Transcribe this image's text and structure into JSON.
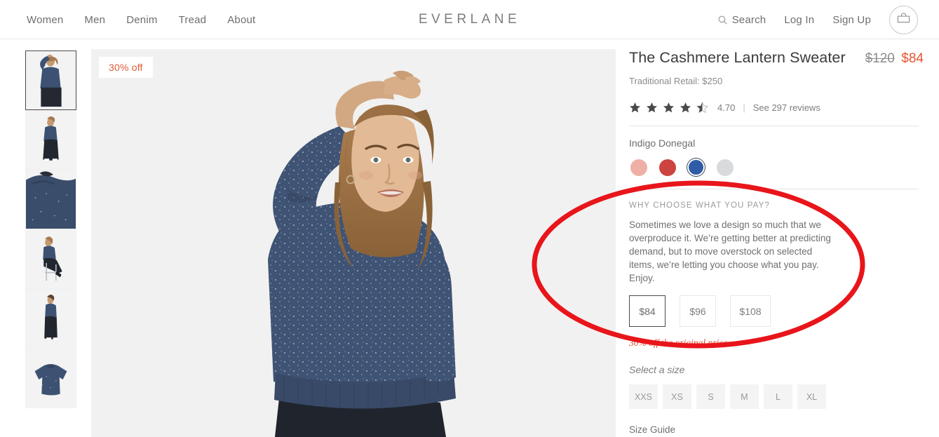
{
  "header": {
    "brand": "EVERLANE",
    "nav": [
      {
        "label": "Women"
      },
      {
        "label": "Men"
      },
      {
        "label": "Denim"
      },
      {
        "label": "Tread"
      },
      {
        "label": "About"
      }
    ],
    "search_label": "Search",
    "login_label": "Log In",
    "signup_label": "Sign Up",
    "search_icon": "search-icon",
    "bag_icon": "shopping-bag-icon"
  },
  "gallery": {
    "badge": "30% off",
    "thumbnails": [
      {
        "alt": "model arm raised",
        "selected": true
      },
      {
        "alt": "model full length standing"
      },
      {
        "alt": "fabric detail close up"
      },
      {
        "alt": "model seated on stool"
      },
      {
        "alt": "model side view"
      },
      {
        "alt": "flat lay sweater"
      }
    ]
  },
  "product": {
    "title": "The Cashmere Lantern Sweater",
    "price_original": "$120",
    "price_current": "$84",
    "retail": "Traditional Retail: $250",
    "rating_value": "4.70",
    "rating_stars": 4.5,
    "rating_separator": "|",
    "reviews_link": "See 297 reviews",
    "color_name": "Indigo Donegal",
    "colors": [
      {
        "name": "blush",
        "hex": "#eeb0a6",
        "selected": false
      },
      {
        "name": "red",
        "hex": "#cc4340",
        "selected": false
      },
      {
        "name": "indigo",
        "hex": "#2f5ca6",
        "selected": true
      },
      {
        "name": "light-grey",
        "hex": "#d9dadc",
        "selected": false
      }
    ]
  },
  "choose_price": {
    "heading": "WHY CHOOSE WHAT YOU PAY?",
    "body": "Sometimes we love a design so much that we overproduce it. We’re getting better at predicting demand, but to move overstock on selected items, we’re letting you choose what you pay. Enjoy.",
    "options": [
      {
        "label": "$84",
        "selected": true
      },
      {
        "label": "$96",
        "selected": false
      },
      {
        "label": "$108",
        "selected": false
      }
    ],
    "note": "30% off the original price"
  },
  "sizing": {
    "label": "Select a size",
    "sizes": [
      {
        "label": "XXS"
      },
      {
        "label": "XS"
      },
      {
        "label": "S"
      },
      {
        "label": "M"
      },
      {
        "label": "L"
      },
      {
        "label": "XL"
      }
    ],
    "size_guide": "Size Guide"
  },
  "annotation": {
    "shape": "ellipse-highlight",
    "color": "#e8151b",
    "target": "why-choose-what-you-pay-section"
  }
}
